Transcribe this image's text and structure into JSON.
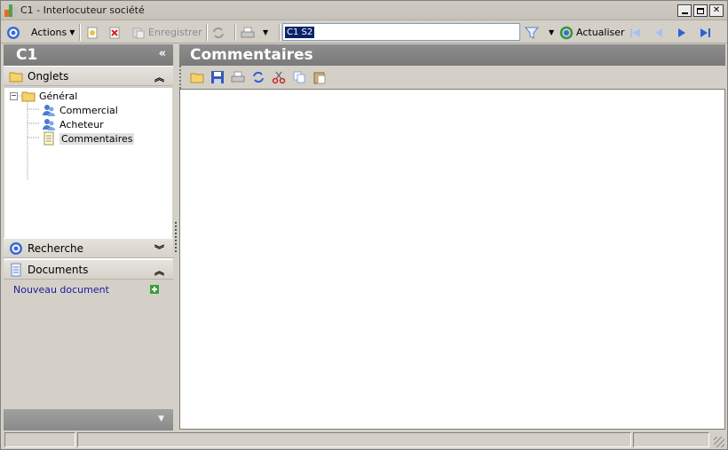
{
  "window": {
    "title": "C1 -  Interlocuteur société",
    "buttons": [
      "minimize",
      "maximize",
      "close"
    ]
  },
  "toolbar": {
    "actions_label": "Actions",
    "save_label": "Enregistrer",
    "search_value": "C1 S2",
    "refresh_label": "Actualiser"
  },
  "left_panel": {
    "title": "C1",
    "tabs_section": "Onglets",
    "tree": {
      "root": "Général",
      "items": [
        "Commercial",
        "Acheteur",
        "Commentaires"
      ],
      "selected": "Commentaires"
    },
    "search_section": "Recherche",
    "documents_section": "Documents",
    "new_document_link": "Nouveau document"
  },
  "main": {
    "title": "Commentaires"
  },
  "colors": {
    "header_gray": "#858585",
    "selection_blue": "#0a246a",
    "link_blue": "#1a1a9e"
  }
}
